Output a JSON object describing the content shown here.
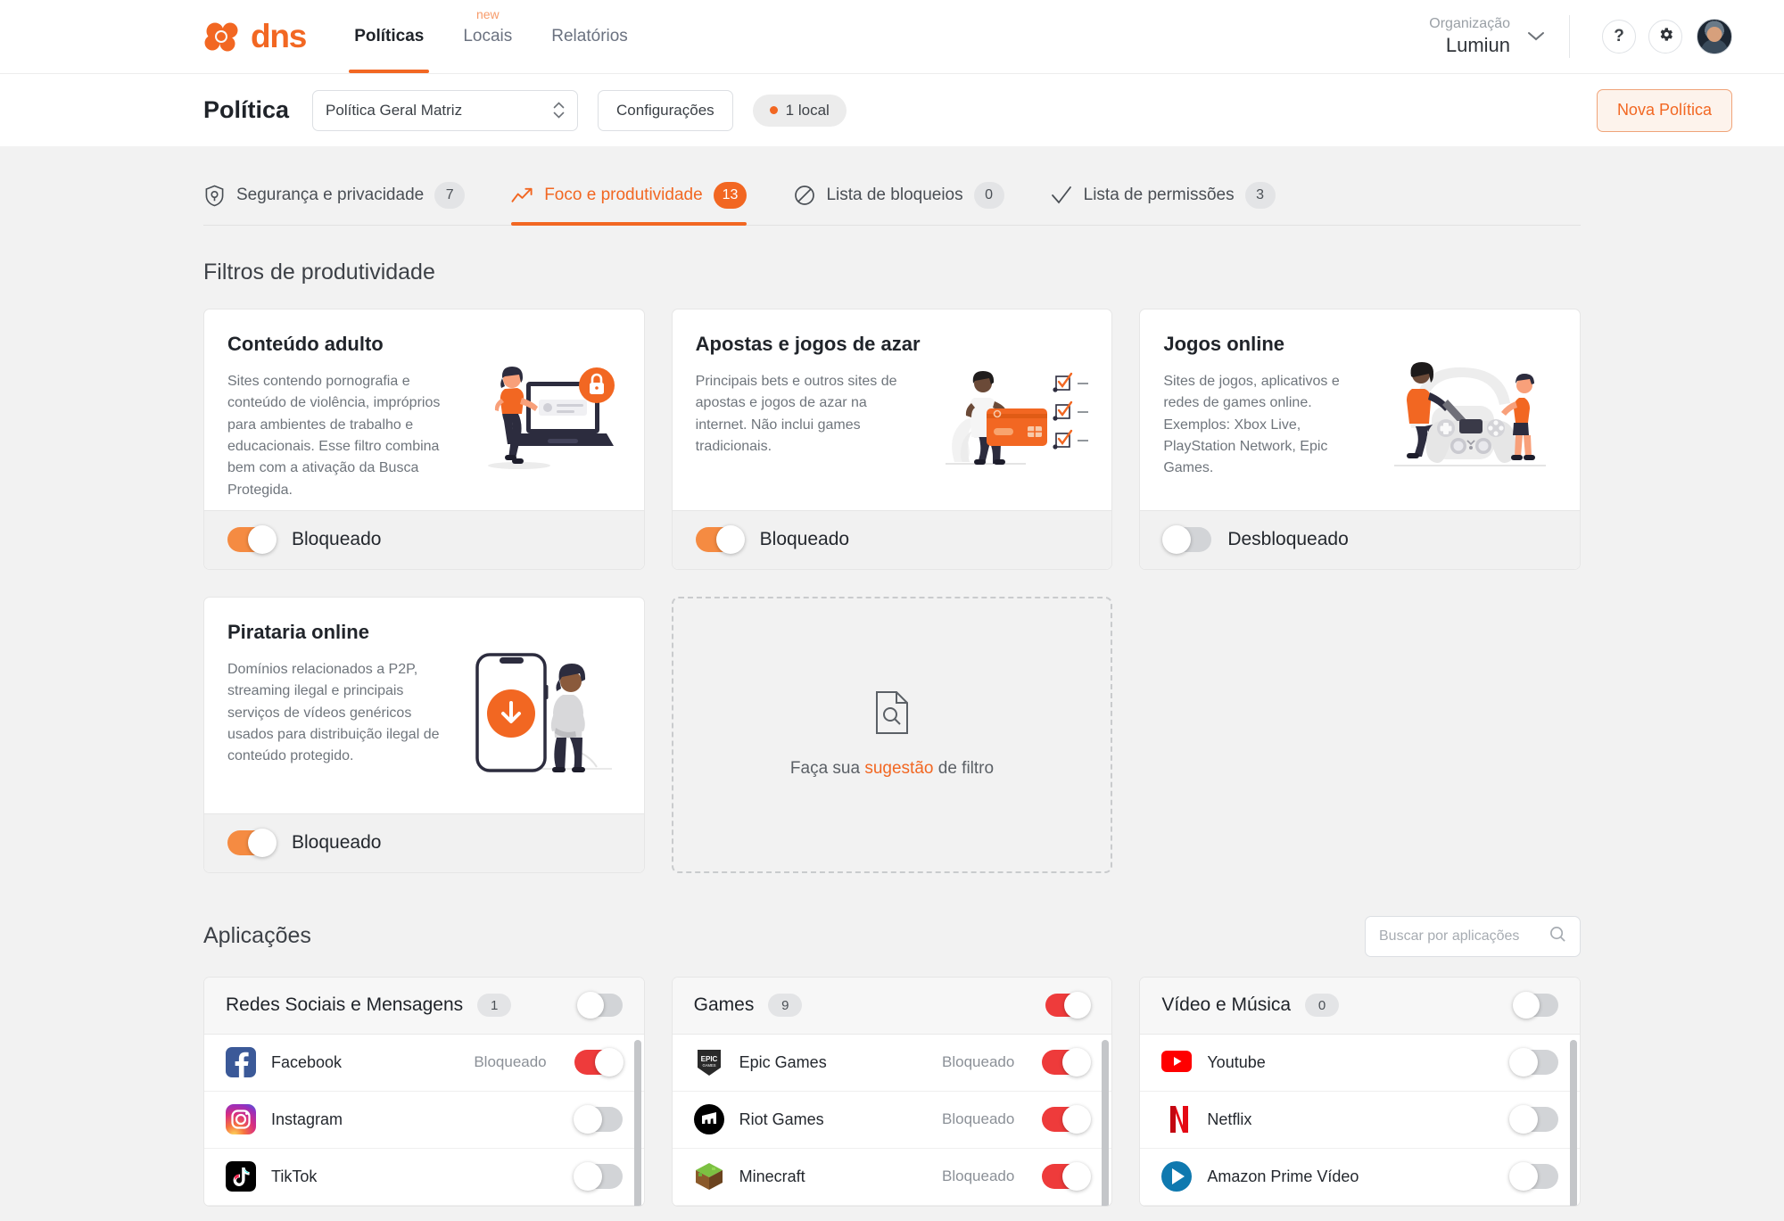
{
  "brand": {
    "name": "dns",
    "accent": "#F26722"
  },
  "topnav": {
    "links": [
      {
        "label": "Políticas",
        "active": true,
        "badge": ""
      },
      {
        "label": "Locais",
        "active": false,
        "badge": "new"
      },
      {
        "label": "Relatórios",
        "active": false,
        "badge": ""
      }
    ],
    "org_label": "Organização",
    "org_name": "Lumiun",
    "help_icon": "?",
    "settings_icon": "gear-icon",
    "avatar_icon": "user-avatar"
  },
  "policybar": {
    "title": "Política",
    "select_value": "Política Geral Matriz",
    "config_button": "Configurações",
    "locals_pill": "1 local",
    "new_policy_button": "Nova Política"
  },
  "tabs": [
    {
      "label": "Segurança e privacidade",
      "count": "7",
      "active": false,
      "icon": "shield-icon"
    },
    {
      "label": "Foco e produtividade",
      "count": "13",
      "active": true,
      "icon": "trending-up-icon"
    },
    {
      "label": "Lista de bloqueios",
      "count": "0",
      "active": false,
      "icon": "block-icon"
    },
    {
      "label": "Lista de permissões",
      "count": "3",
      "active": false,
      "icon": "check-icon"
    }
  ],
  "filters_section": {
    "title": "Filtros de produtividade",
    "cards": [
      {
        "title": "Conteúdo adulto",
        "description": "Sites contendo pornografia e conteúdo de violência, impróprios para ambientes de trabalho e educacionais. Esse filtro combina bem com a ativação da Busca Protegida.",
        "state_label": "Bloqueado",
        "enabled": true,
        "art": "laptop-lock-illustration"
      },
      {
        "title": "Apostas e jogos de azar",
        "description": "Principais bets e outros sites de apostas e jogos de azar na internet. Não inclui games tradicionais.",
        "state_label": "Bloqueado",
        "enabled": true,
        "art": "wallet-checklist-illustration"
      },
      {
        "title": "Jogos online",
        "description": "Sites de jogos, aplicativos e redes de games online. Exemplos: Xbox Live, PlayStation Network, Epic Games.",
        "state_label": "Desbloqueado",
        "enabled": false,
        "art": "gamepad-illustration"
      },
      {
        "title": "Pirataria online",
        "description": "Domínios relacionados a P2P, streaming ilegal e principais serviços de vídeos genéricos usados para distribuição ilegal de conteúdo protegido.",
        "state_label": "Bloqueado",
        "enabled": true,
        "art": "phone-download-illustration"
      }
    ],
    "suggestion": {
      "prefix": "Faça sua ",
      "link": "sugestão",
      "suffix": " de filtro",
      "icon": "document-search-icon"
    }
  },
  "apps_section": {
    "title": "Aplicações",
    "search_placeholder": "Buscar por aplicações",
    "search_value": "",
    "search_icon": "search-icon",
    "categories": [
      {
        "name": "Redes Sociais e Mensagens",
        "count": "1",
        "enabled": false,
        "apps": [
          {
            "name": "Facebook",
            "status": "Bloqueado",
            "enabled": true,
            "icon": "facebook-icon"
          },
          {
            "name": "Instagram",
            "status": "",
            "enabled": false,
            "icon": "instagram-icon"
          },
          {
            "name": "TikTok",
            "status": "",
            "enabled": false,
            "icon": "tiktok-icon"
          }
        ]
      },
      {
        "name": "Games",
        "count": "9",
        "enabled": true,
        "apps": [
          {
            "name": "Epic Games",
            "status": "Bloqueado",
            "enabled": true,
            "icon": "epic-games-icon"
          },
          {
            "name": "Riot Games",
            "status": "Bloqueado",
            "enabled": true,
            "icon": "riot-games-icon"
          },
          {
            "name": "Minecraft",
            "status": "Bloqueado",
            "enabled": true,
            "icon": "minecraft-icon"
          }
        ]
      },
      {
        "name": "Vídeo e Música",
        "count": "0",
        "enabled": false,
        "apps": [
          {
            "name": "Youtube",
            "status": "",
            "enabled": false,
            "icon": "youtube-icon"
          },
          {
            "name": "Netflix",
            "status": "",
            "enabled": false,
            "icon": "netflix-icon"
          },
          {
            "name": "Amazon Prime Vídeo",
            "status": "",
            "enabled": false,
            "icon": "amazon-prime-icon"
          }
        ]
      }
    ]
  }
}
